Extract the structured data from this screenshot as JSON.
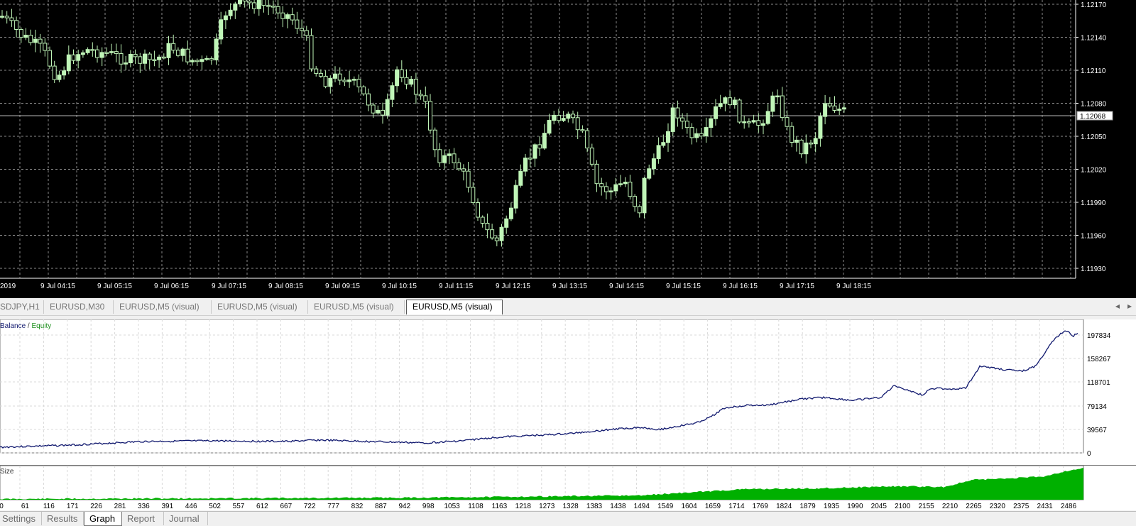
{
  "price_chart": {
    "bg": "#000000",
    "candle_color": "#c0f6b8",
    "grid_color": "#8a8a8a",
    "y_labels": [
      "1.12170",
      "1.12140",
      "1.12110",
      "1.12080",
      "1.12050",
      "1.12020",
      "1.11990",
      "1.11960",
      "1.11930"
    ],
    "current_price": "1.12068",
    "x_labels": [
      "2019",
      "9 Jul 04:15",
      "9 Jul 05:15",
      "9 Jul 06:15",
      "9 Jul 07:15",
      "9 Jul 08:15",
      "9 Jul 09:15",
      "9 Jul 10:15",
      "9 Jul 11:15",
      "9 Jul 12:15",
      "9 Jul 13:15",
      "9 Jul 14:15",
      "9 Jul 15:15",
      "9 Jul 16:15",
      "9 Jul 17:15",
      "9 Jul 18:15"
    ]
  },
  "chart_tabs": [
    {
      "label": "SDJPY,H1",
      "active": false
    },
    {
      "label": "EURUSD,M30",
      "active": false
    },
    {
      "label": "EURUSD,M5 (visual)",
      "active": false
    },
    {
      "label": "EURUSD,M5 (visual)",
      "active": false
    },
    {
      "label": "EURUSD,M5 (visual)",
      "active": false
    },
    {
      "label": "EURUSD,M5 (visual)",
      "active": true
    }
  ],
  "tab_nav": {
    "prev": "◂",
    "next": "▸"
  },
  "balance_graph": {
    "legend_balance": "Balance",
    "legend_sep": "/",
    "legend_equity": "Equity",
    "balance_color": "#10186e",
    "equity_color": "#1d8f1d",
    "y_labels": [
      "197834",
      "158267",
      "118701",
      "79134",
      "39567",
      "0"
    ]
  },
  "size_graph": {
    "label": "Size",
    "fill_color": "#00b000"
  },
  "x_axis": {
    "labels": [
      "0",
      "61",
      "116",
      "171",
      "226",
      "281",
      "336",
      "391",
      "446",
      "502",
      "557",
      "612",
      "667",
      "722",
      "777",
      "832",
      "887",
      "942",
      "998",
      "1053",
      "1108",
      "1163",
      "1218",
      "1273",
      "1328",
      "1383",
      "1438",
      "1494",
      "1549",
      "1604",
      "1659",
      "1714",
      "1769",
      "1824",
      "1879",
      "1935",
      "1990",
      "2045",
      "2100",
      "2155",
      "2210",
      "2265",
      "2320",
      "2375",
      "2431",
      "2486"
    ]
  },
  "bottom_tabs": [
    {
      "label": "Settings",
      "active": false
    },
    {
      "label": "Results",
      "active": false
    },
    {
      "label": "Graph",
      "active": true
    },
    {
      "label": "Report",
      "active": false
    },
    {
      "label": "Journal",
      "active": false
    }
  ]
}
